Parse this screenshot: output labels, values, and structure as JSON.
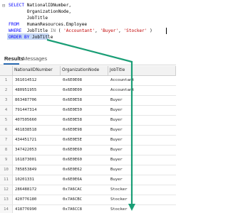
{
  "editor": {
    "lines": [
      {
        "parts": [
          [
            "kw",
            "SELECT "
          ],
          [
            "id",
            "NationalIDNumber,"
          ]
        ]
      },
      {
        "parts": [
          [
            "id",
            "       OrganizationNode,"
          ]
        ]
      },
      {
        "parts": [
          [
            "id",
            "       JobTitle"
          ]
        ]
      },
      {
        "parts": [
          [
            "kw",
            "FROM   "
          ],
          [
            "id",
            "HumanResources.Employee"
          ]
        ]
      },
      {
        "parts": [
          [
            "kw",
            "WHERE  "
          ],
          [
            "id",
            "JobTitle "
          ],
          [
            "op",
            "IN "
          ],
          [
            "id",
            "( "
          ],
          [
            "str",
            "'Accountant'"
          ],
          [
            "id",
            ", "
          ],
          [
            "str",
            "'Buyer'"
          ],
          [
            "id",
            ", "
          ],
          [
            "str",
            "'Stocker'"
          ],
          [
            "id",
            " )"
          ]
        ]
      },
      {
        "parts": [
          [
            "kw",
            "ORDER BY "
          ],
          [
            "id",
            "JobTitle"
          ]
        ]
      }
    ],
    "gutter_marker": "⊟"
  },
  "tabs": {
    "results": "Results",
    "messages": "Messages"
  },
  "grid": {
    "columns": [
      "",
      "NationalIDNumber",
      "OrganizationNode",
      "JobTitle"
    ],
    "rows": [
      [
        "1",
        "361014512",
        "0x6E0E08",
        "Accountant"
      ],
      [
        "2",
        "480951955",
        "0x6E0E00",
        "Accountant"
      ],
      [
        "3",
        "863487706",
        "0x6E0E58",
        "Buyer"
      ],
      [
        "4",
        "791447314",
        "0x6E0E50",
        "Buyer"
      ],
      [
        "5",
        "407505660",
        "0x6E0E58",
        "Buyer"
      ],
      [
        "6",
        "461838518",
        "0x6E0E98",
        "Buyer"
      ],
      [
        "7",
        "434451721",
        "0x6E0E5E",
        "Buyer"
      ],
      [
        "8",
        "347422053",
        "0x6E0E60",
        "Buyer"
      ],
      [
        "9",
        "161873001",
        "0x6E0E60",
        "Buyer"
      ],
      [
        "10",
        "785853849",
        "0x6E0E62",
        "Buyer"
      ],
      [
        "11",
        "10201331",
        "0x6E0E6A",
        "Buyer"
      ],
      [
        "12",
        "286488172",
        "0x7A6CAC",
        "Stocker"
      ],
      [
        "13",
        "420776180",
        "0x7A6CBC",
        "Stocker"
      ],
      [
        "14",
        "418776990",
        "0x7A6CC8",
        "Stocker"
      ]
    ]
  },
  "colors": {
    "accent_arrow": "#1a9e76",
    "keyword": "#0000ff",
    "string": "#c00000"
  }
}
